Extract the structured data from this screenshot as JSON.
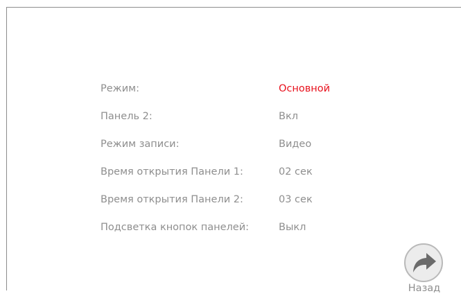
{
  "settings": [
    {
      "label": "Режим:",
      "value": "Основной",
      "selected": true
    },
    {
      "label": "Панель 2:",
      "value": "Вкл",
      "selected": false
    },
    {
      "label": "Режим записи:",
      "value": "Видео",
      "selected": false
    },
    {
      "label": "Время открытия Панели 1:",
      "value": "02 сек",
      "selected": false
    },
    {
      "label": "Время открытия Панели 2:",
      "value": "03 сек",
      "selected": false
    },
    {
      "label": "Подсветка кнопок панелей:",
      "value": "Выкл",
      "selected": false
    }
  ],
  "back": {
    "label": "Назад",
    "icon": "forward-arrow-icon"
  },
  "colors": {
    "text": "#8e8e8e",
    "selected_value": "#e8101c",
    "frame": "#8c8c8c",
    "button_fill": "#ececec",
    "button_border": "#b9b9b9",
    "arrow": "#6b6b6b"
  }
}
